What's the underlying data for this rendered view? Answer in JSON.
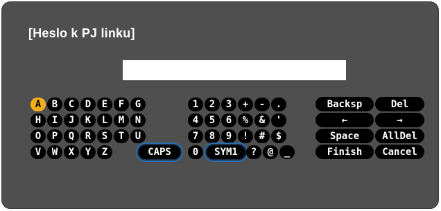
{
  "dialog": {
    "title": "[Heslo k PJ linku]"
  },
  "password": {
    "value": "",
    "placeholder": ""
  },
  "letters": [
    [
      "A",
      "B",
      "C",
      "D",
      "E",
      "F",
      "G"
    ],
    [
      "H",
      "I",
      "J",
      "K",
      "L",
      "M",
      "N"
    ],
    [
      "O",
      "P",
      "Q",
      "R",
      "S",
      "T",
      "U"
    ],
    [
      "V",
      "W",
      "X",
      "Y",
      "Z"
    ]
  ],
  "caps_label": "CAPS",
  "symbols": [
    [
      "1",
      "2",
      "3",
      "+",
      "-",
      "."
    ],
    [
      "4",
      "5",
      "6",
      "%",
      "&",
      "'"
    ],
    [
      "7",
      "8",
      "9",
      "!",
      "#",
      "$"
    ],
    [
      "0"
    ]
  ],
  "sym_label": "SYM1",
  "symbols_tail": [
    "?",
    "@",
    "_"
  ],
  "functions": {
    "backspace": "Backsp",
    "delete": "Del",
    "left": "←",
    "right": "→",
    "space": "Space",
    "alldel": "AllDel",
    "finish": "Finish",
    "cancel": "Cancel"
  },
  "selected_key": "A",
  "colors": {
    "panel": "#4f4f4f",
    "key": "#000000",
    "key_text": "#ffffff",
    "selected": "#f3b01c",
    "highlight_ring": "#2a6fb0"
  }
}
